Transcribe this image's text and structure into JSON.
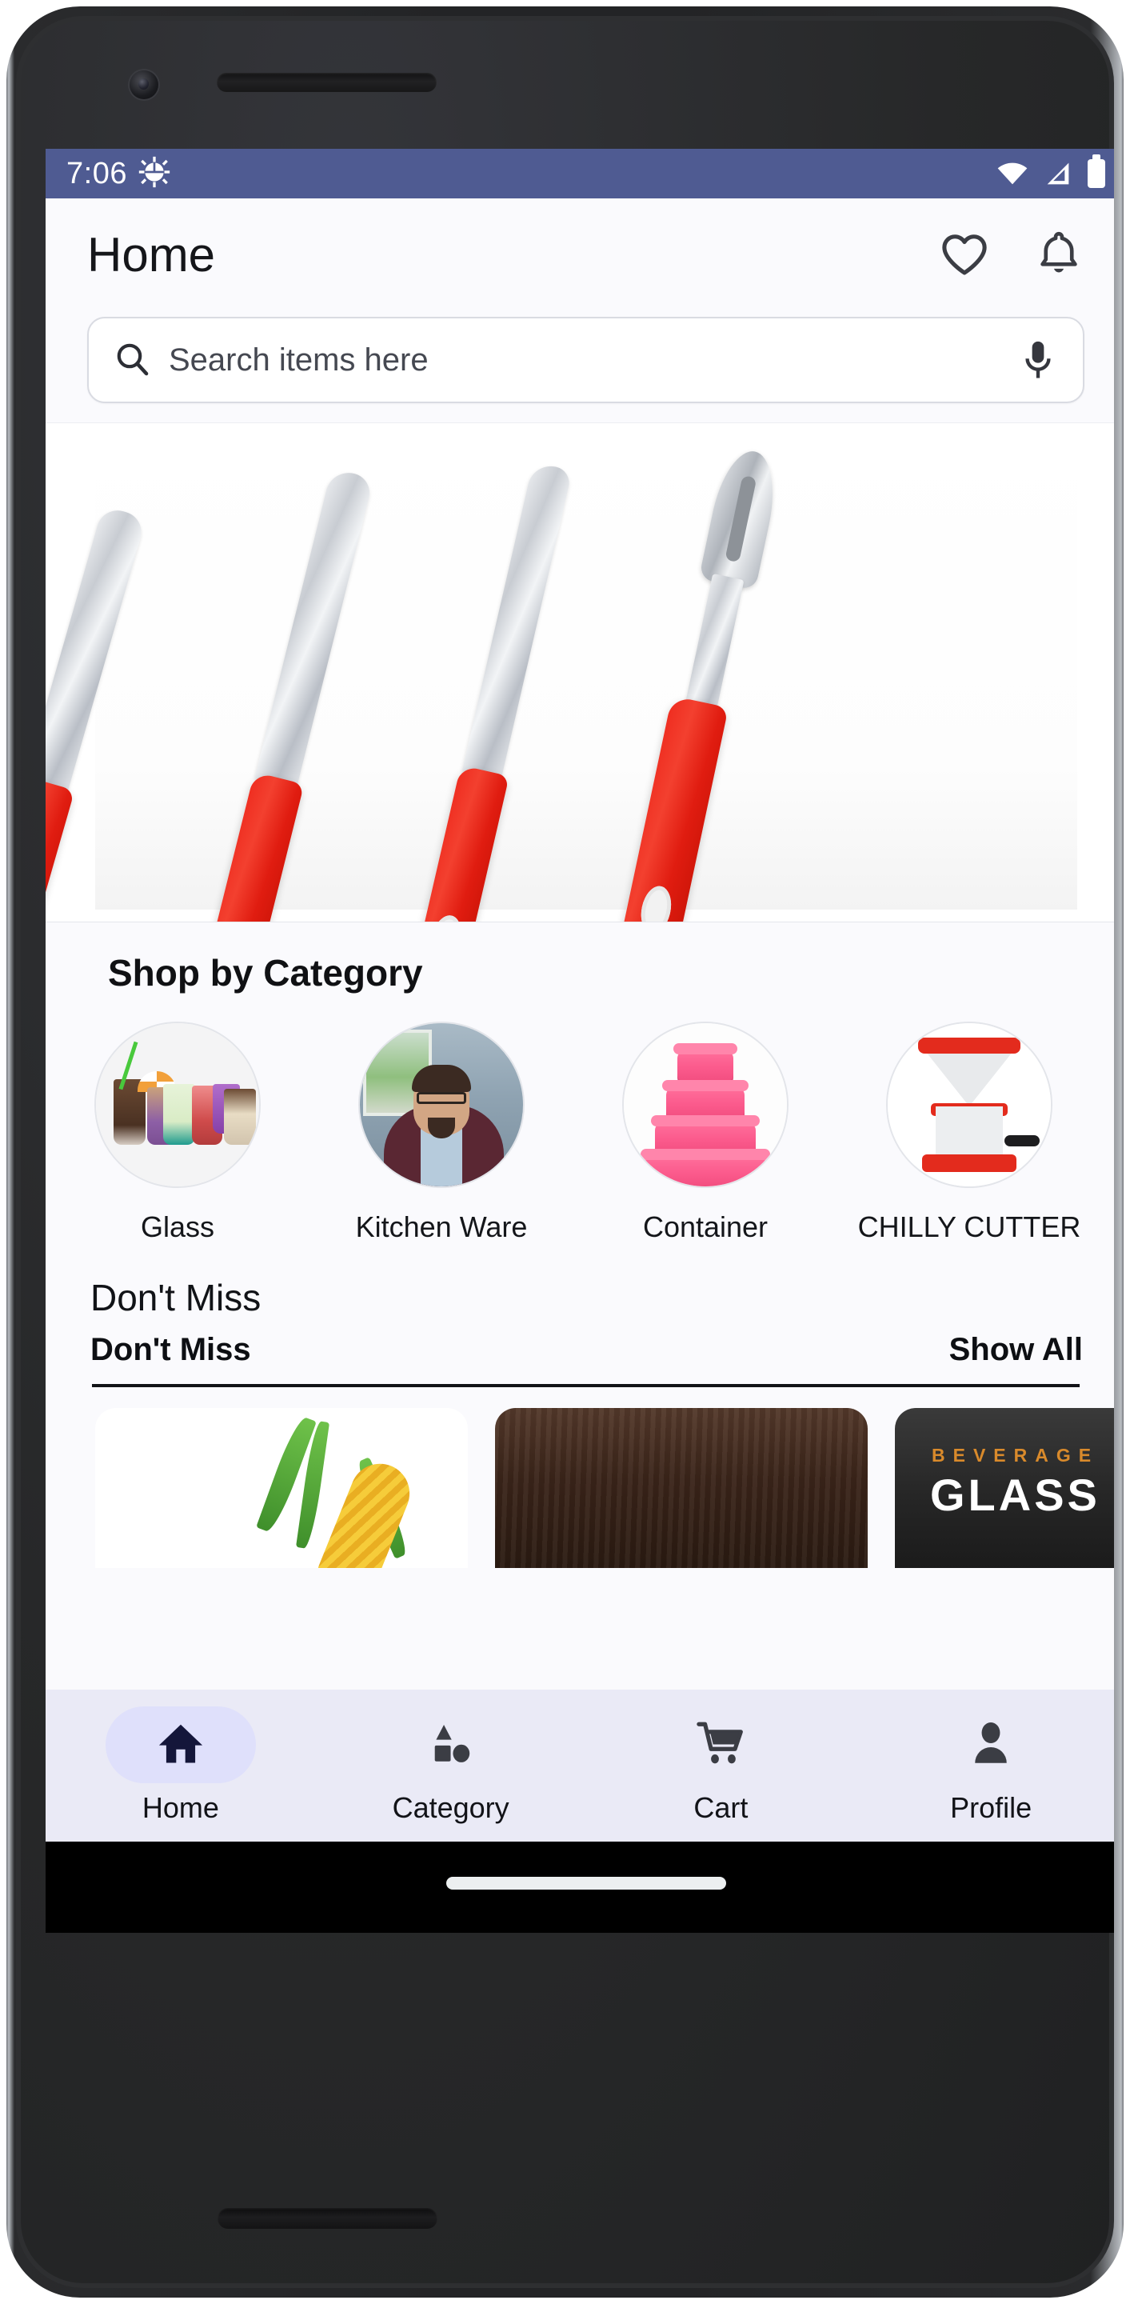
{
  "status_bar": {
    "time": "7:06",
    "icons": [
      "bug-gear-icon",
      "wifi-icon",
      "cellular-signal-icon",
      "battery-icon"
    ],
    "background_color": "#4f5b92"
  },
  "app_bar": {
    "title": "Home",
    "actions": [
      {
        "name": "favorites",
        "icon": "heart-icon"
      },
      {
        "name": "notifications",
        "icon": "bell-icon"
      }
    ]
  },
  "search": {
    "placeholder": "Search items here",
    "value": "",
    "leading_icon": "search-icon",
    "trailing_icon": "microphone-icon"
  },
  "banner": {
    "alt": "knife-set-banner",
    "items": [
      "bread-knife",
      "utility-knife",
      "paring-knife",
      "vegetable-peeler"
    ],
    "handle_color": "#e32b1d",
    "blade_color": "#c8ccd2"
  },
  "categories": {
    "title": "Shop by Category",
    "items": [
      {
        "label": "Glass",
        "thumb": "beverage-glasses-thumbnail"
      },
      {
        "label": "Kitchen Ware",
        "thumb": "person-portrait-thumbnail"
      },
      {
        "label": "Container",
        "thumb": "pink-containers-thumbnail"
      },
      {
        "label": "CHILLY CUTTER",
        "thumb": "chilly-cutter-thumbnail"
      }
    ]
  },
  "dont_miss": {
    "heading": "Don't Miss",
    "subheading": "Don't Miss",
    "show_all": "Show All",
    "products": [
      {
        "name": "corn-product-card",
        "caption": ""
      },
      {
        "name": "dark-product-card",
        "caption": ""
      },
      {
        "name": "beverage-glass-card",
        "caption_small": "BEVERAGE",
        "caption_large": "GLASS"
      }
    ]
  },
  "bottom_nav": {
    "active": "Home",
    "active_pill_color": "#dfe0fb",
    "background_color": "#eaeaf6",
    "items": [
      {
        "label": "Home",
        "icon": "home-icon"
      },
      {
        "label": "Category",
        "icon": "category-shapes-icon"
      },
      {
        "label": "Cart",
        "icon": "shopping-cart-icon"
      },
      {
        "label": "Profile",
        "icon": "person-icon"
      }
    ]
  }
}
